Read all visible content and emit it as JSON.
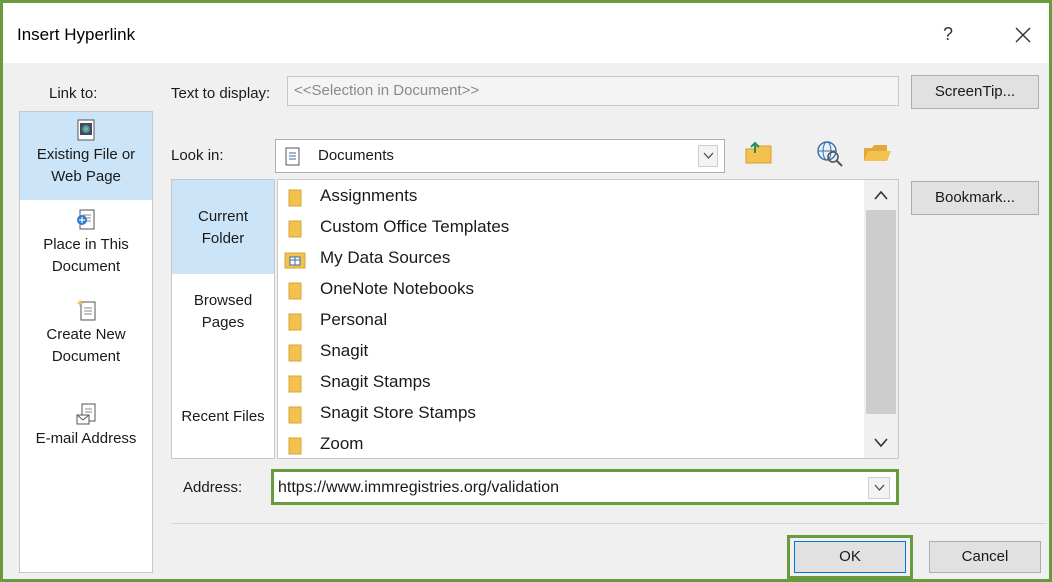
{
  "window": {
    "title": "Insert Hyperlink",
    "help_label": "?"
  },
  "link_to": {
    "label": "Link to:",
    "items": [
      {
        "line1": "Existing File or",
        "line2": "Web Page",
        "icon": "existing-file-icon",
        "selected": true
      },
      {
        "line1": "Place in This",
        "line2": "Document",
        "icon": "place-in-document-icon",
        "selected": false
      },
      {
        "line1": "Create New",
        "line2": "Document",
        "icon": "create-new-document-icon",
        "selected": false
      },
      {
        "line1": "E-mail Address",
        "line2": "",
        "icon": "email-address-icon",
        "selected": false
      }
    ]
  },
  "text_to_display": {
    "label": "Text to display:",
    "value": "<<Selection in Document>>"
  },
  "look_in": {
    "label": "Look in:",
    "value": "Documents"
  },
  "nav": {
    "items": [
      {
        "line1": "Current",
        "line2": "Folder",
        "selected": true
      },
      {
        "line1": "Browsed",
        "line2": "Pages",
        "selected": false
      },
      {
        "line1": "Recent Files",
        "line2": "",
        "selected": false
      }
    ]
  },
  "files": [
    {
      "name": "Assignments",
      "icon": "folder-icon"
    },
    {
      "name": "Custom Office Templates",
      "icon": "folder-icon"
    },
    {
      "name": "My Data Sources",
      "icon": "data-sources-folder-icon"
    },
    {
      "name": "OneNote Notebooks",
      "icon": "folder-icon"
    },
    {
      "name": "Personal",
      "icon": "folder-icon"
    },
    {
      "name": "Snagit",
      "icon": "folder-icon"
    },
    {
      "name": "Snagit Stamps",
      "icon": "folder-icon"
    },
    {
      "name": "Snagit Store Stamps",
      "icon": "folder-icon"
    },
    {
      "name": "Zoom",
      "icon": "folder-icon"
    }
  ],
  "address": {
    "label": "Address:",
    "value": "https://www.immregistries.org/validation"
  },
  "buttons": {
    "screentip": "ScreenTip...",
    "bookmark": "Bookmark...",
    "ok": "OK",
    "cancel": "Cancel"
  },
  "colors": {
    "highlight_border": "#6a9a3e",
    "selection": "#cce4f7",
    "folder": "#f2c14e"
  }
}
